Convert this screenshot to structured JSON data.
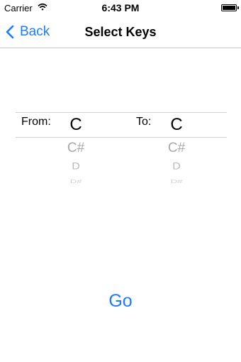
{
  "status_bar": {
    "carrier": "Carrier",
    "time": "6:43 PM"
  },
  "nav": {
    "back_label": "Back",
    "title": "Select Keys"
  },
  "picker": {
    "from_label": "From:",
    "to_label": "To:",
    "from_selected": "C",
    "from_following": [
      "C#",
      "D",
      "D#"
    ],
    "to_selected": "C",
    "to_following": [
      "C#",
      "D",
      "D#"
    ]
  },
  "go_label": "Go",
  "colors": {
    "accent": "#1a7cff",
    "separator": "#c8c7cc"
  }
}
